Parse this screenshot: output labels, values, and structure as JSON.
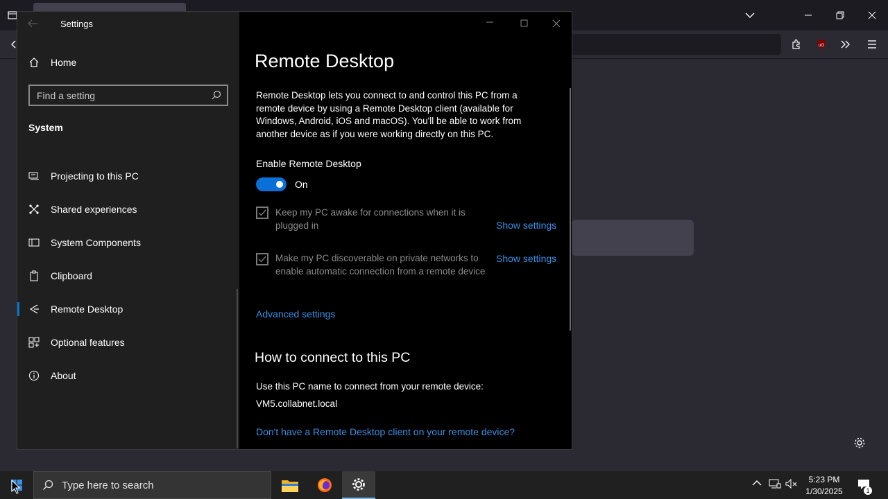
{
  "settings": {
    "window_title": "Settings",
    "home_label": "Home",
    "search_placeholder": "Find a setting",
    "section_label": "System",
    "nav_items": [
      {
        "label": "Projecting to this PC",
        "icon": "projector-icon"
      },
      {
        "label": "Shared experiences",
        "icon": "shared-icon"
      },
      {
        "label": "System Components",
        "icon": "components-icon"
      },
      {
        "label": "Clipboard",
        "icon": "clipboard-icon"
      },
      {
        "label": "Remote Desktop",
        "icon": "remote-desktop-icon",
        "selected": true
      },
      {
        "label": "Optional features",
        "icon": "optional-features-icon"
      },
      {
        "label": "About",
        "icon": "info-icon"
      }
    ]
  },
  "remote": {
    "heading": "Remote Desktop",
    "description": "Remote Desktop lets you connect to and control this PC from a remote device by using a Remote Desktop client (available for Windows, Android, iOS and macOS). You'll be able to work from another device as if you were working directly on this PC.",
    "enable_label": "Enable Remote Desktop",
    "toggle_state": "On",
    "toggle_on": true,
    "option1": "Keep my PC awake for connections when it is plugged in",
    "option1_link": "Show settings",
    "option2": "Make my PC discoverable on private networks to enable automatic connection from a remote device",
    "option2_link": "Show settings",
    "advanced_link": "Advanced settings",
    "connect_heading": "How to connect to this PC",
    "connect_text": "Use this PC name to connect from your remote device:",
    "pc_name": "VM5.collabnet.local",
    "client_link": "Don't have a Remote Desktop client on your remote device?"
  },
  "taskbar": {
    "search_placeholder": "Type here to search",
    "time": "5:23 PM",
    "date": "1/30/2025",
    "notification_count": "1"
  },
  "colors": {
    "accent": "#0078d4",
    "link": "#3b8fe3"
  }
}
